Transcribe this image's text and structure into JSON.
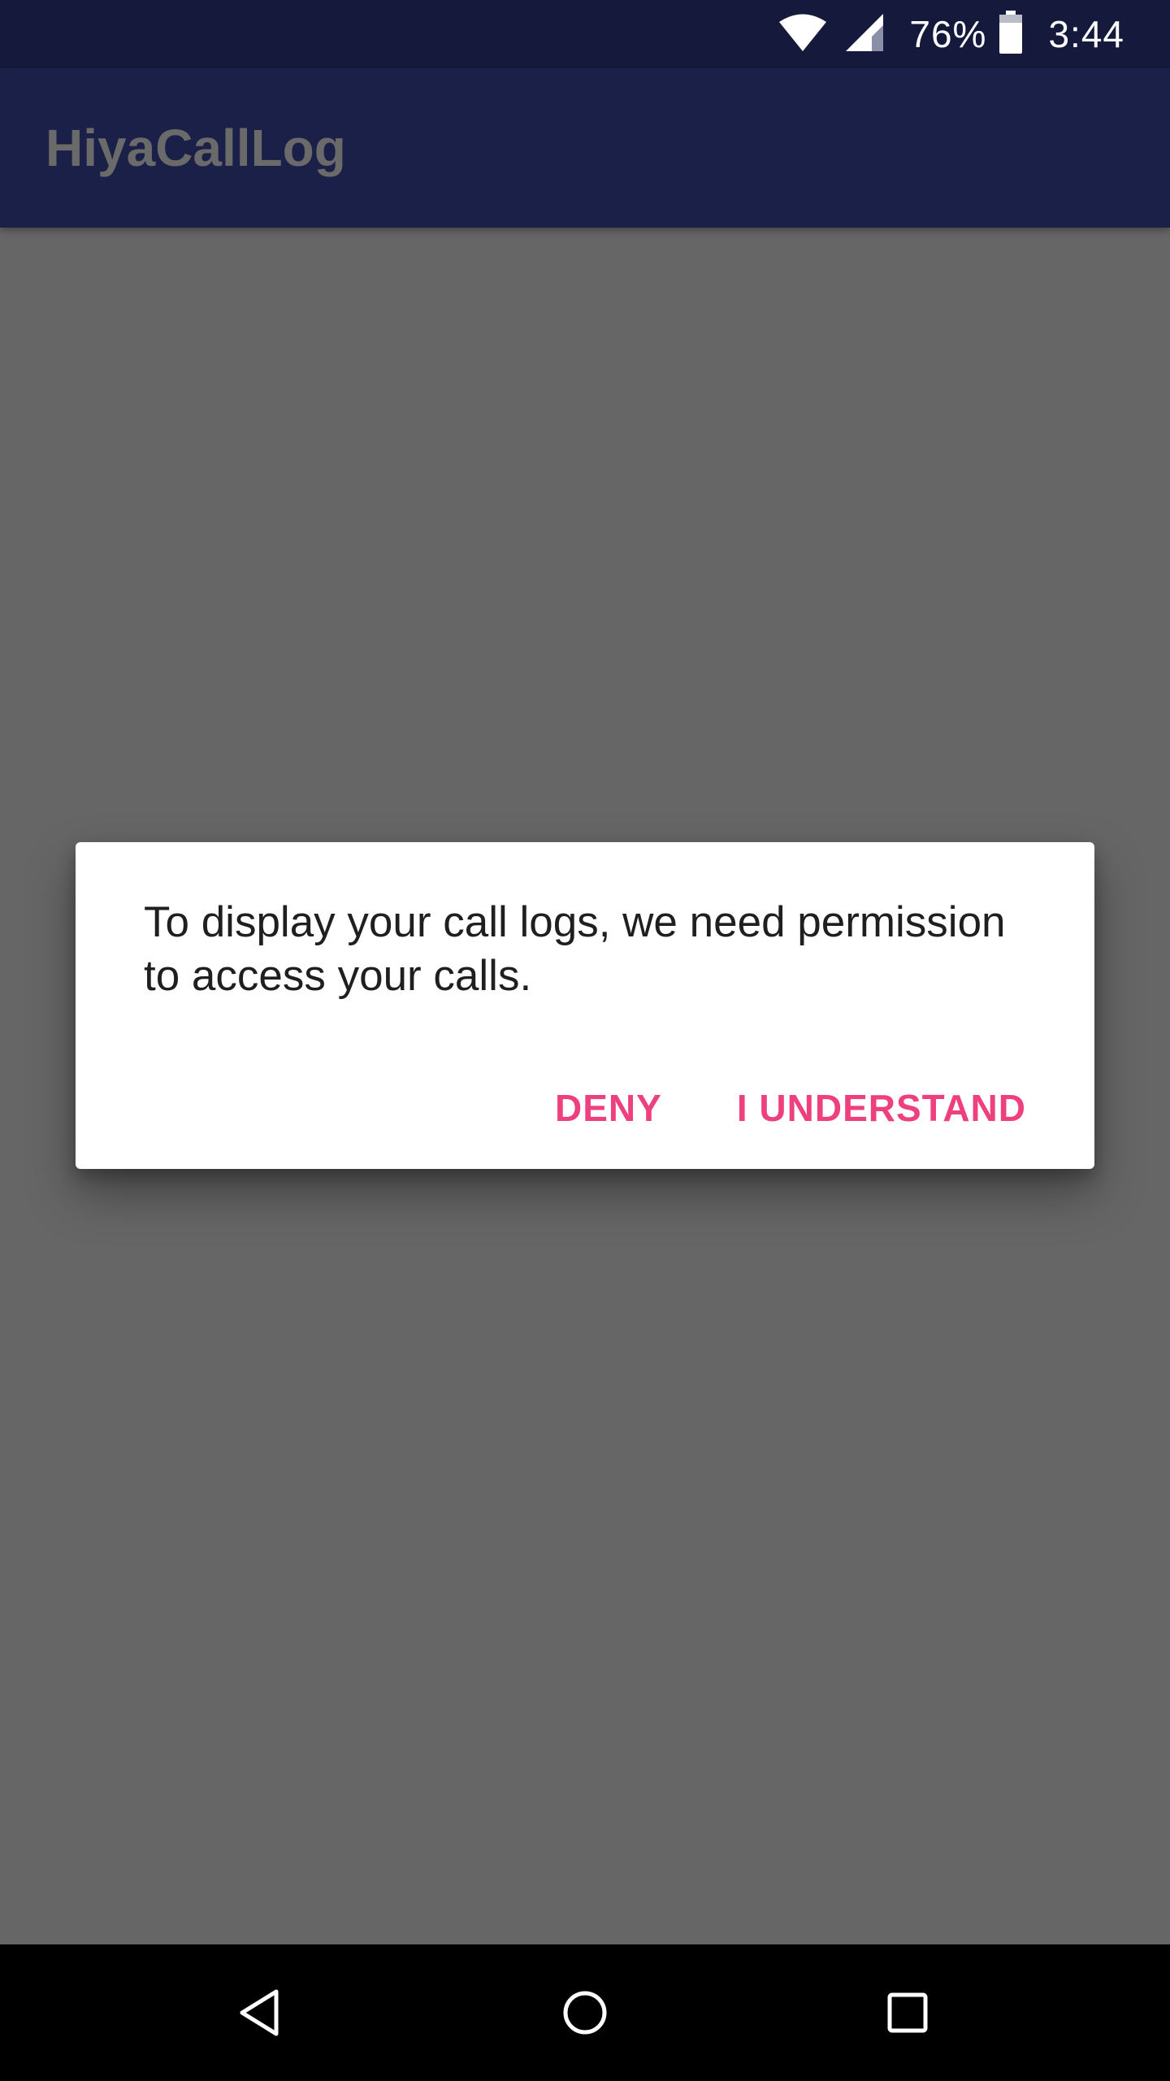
{
  "status_bar": {
    "battery_percent": "76%",
    "time": "3:44",
    "icons": [
      "wifi-icon",
      "cell-signal-icon",
      "battery-icon"
    ]
  },
  "app_bar": {
    "title": "HiyaCallLog"
  },
  "dialog": {
    "message": "To display your call logs, we need permission to access your calls.",
    "deny_label": "DENY",
    "accept_label": "I UNDERSTAND"
  },
  "nav_bar": {
    "icons": [
      "back-icon",
      "home-icon",
      "recents-icon"
    ]
  },
  "colors": {
    "status_bar": "#151a3c",
    "app_bar": "#1b2049",
    "scrim": "#666666",
    "accent": "#ee407e",
    "dialog_text": "#1f1f1f",
    "nav_bar": "#000000"
  }
}
